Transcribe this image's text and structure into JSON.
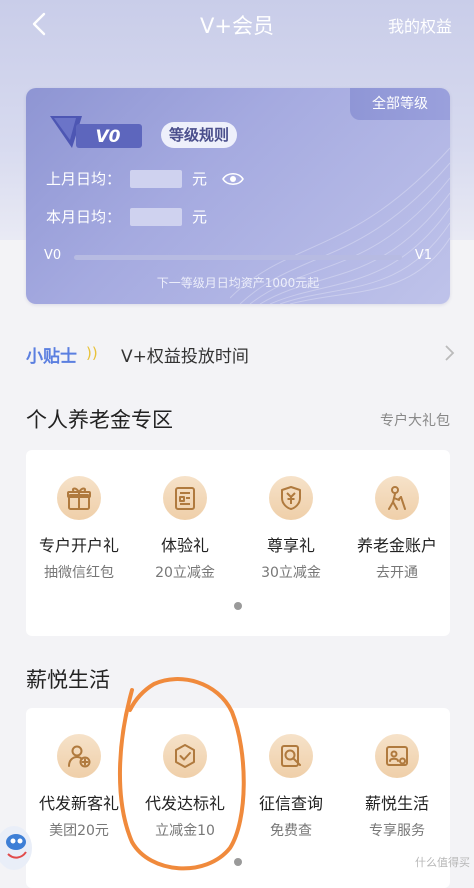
{
  "header": {
    "title": "V+会员",
    "right_link": "我的权益"
  },
  "card": {
    "all_levels": "全部等级",
    "level_badge": "V0",
    "level_rules": "等级规则",
    "last_month_label": "上月日均：",
    "this_month_label": "本月日均：",
    "unit": "元",
    "level_start": "V0",
    "level_end": "V1",
    "progress_fraction": 0,
    "next_level_hint": "下一等级月日均资产1000元起"
  },
  "tips": {
    "tag": "小贴士",
    "wave": "))",
    "text": "V+权益投放时间"
  },
  "pension": {
    "title": "个人养老金专区",
    "link": "专户大礼包",
    "items": [
      {
        "title": "专户开户礼",
        "sub": "抽微信红包",
        "icon": "gift-icon"
      },
      {
        "title": "体验礼",
        "sub": "20立减金",
        "icon": "voucher-icon"
      },
      {
        "title": "尊享礼",
        "sub": "30立减金",
        "icon": "yen-shield-icon"
      },
      {
        "title": "养老金账户",
        "sub": "去开通",
        "icon": "elder-person-icon"
      }
    ]
  },
  "salary_life": {
    "title": "薪悦生活",
    "items": [
      {
        "title": "代发新客礼",
        "sub": "美团20元",
        "icon": "add-user-icon"
      },
      {
        "title": "代发达标礼",
        "sub": "立减金10",
        "icon": "check-shield-icon"
      },
      {
        "title": "征信查询",
        "sub": "免费查",
        "icon": "credit-report-icon"
      },
      {
        "title": "薪悦生活",
        "sub": "专享服务",
        "icon": "id-card-icon"
      }
    ]
  },
  "watermark": "什么值得买",
  "colors": {
    "accent_blue": "#5b7fe0",
    "icon_brown": "#b07a3e",
    "card_purple": "#8e95d3",
    "annotation_orange": "#f08a3c"
  }
}
